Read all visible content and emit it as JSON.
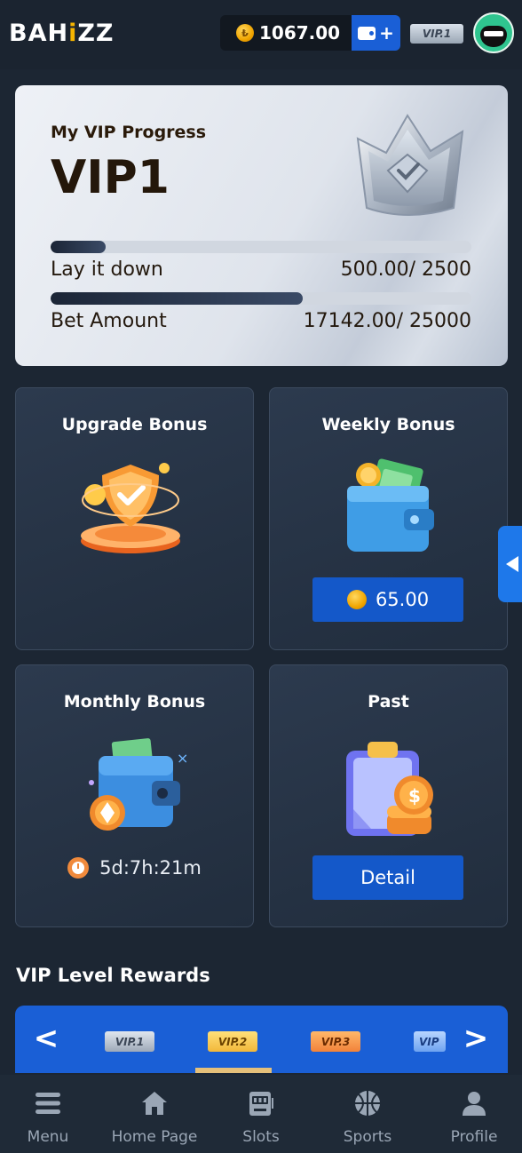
{
  "header": {
    "logo": "BAHiZZ",
    "balance": "1067.00",
    "coin_symbol": "₺",
    "wallet_plus": "+",
    "vip_badge": "VIP.1"
  },
  "vip_progress": {
    "subtitle": "My VIP Progress",
    "level": "VIP1",
    "rows": [
      {
        "label": "Lay it down",
        "value": "500.00/ 2500",
        "progress": 0.13
      },
      {
        "label": "Bet Amount",
        "value": "17142.00/ 25000",
        "progress": 0.6
      }
    ]
  },
  "bonuses": {
    "upgrade": {
      "title": "Upgrade Bonus"
    },
    "weekly": {
      "title": "Weekly Bonus",
      "amount": "65.00"
    },
    "monthly": {
      "title": "Monthly Bonus",
      "countdown": "5d:7h:21m"
    },
    "past": {
      "title": "Past",
      "button": "Detail"
    }
  },
  "rewards": {
    "title": "VIP Level Rewards",
    "levels": [
      "VIP.1",
      "VIP.2",
      "VIP.3",
      "VIP"
    ],
    "selected": "VIP.2",
    "prev_label": "<",
    "next_label": ">"
  },
  "nav": {
    "items": [
      "Menu",
      "Home Page",
      "Slots",
      "Sports",
      "Profile"
    ]
  },
  "colors": {
    "background": "#1c2633",
    "accent_blue": "#1a5fd6",
    "gold": "#f5b400"
  }
}
